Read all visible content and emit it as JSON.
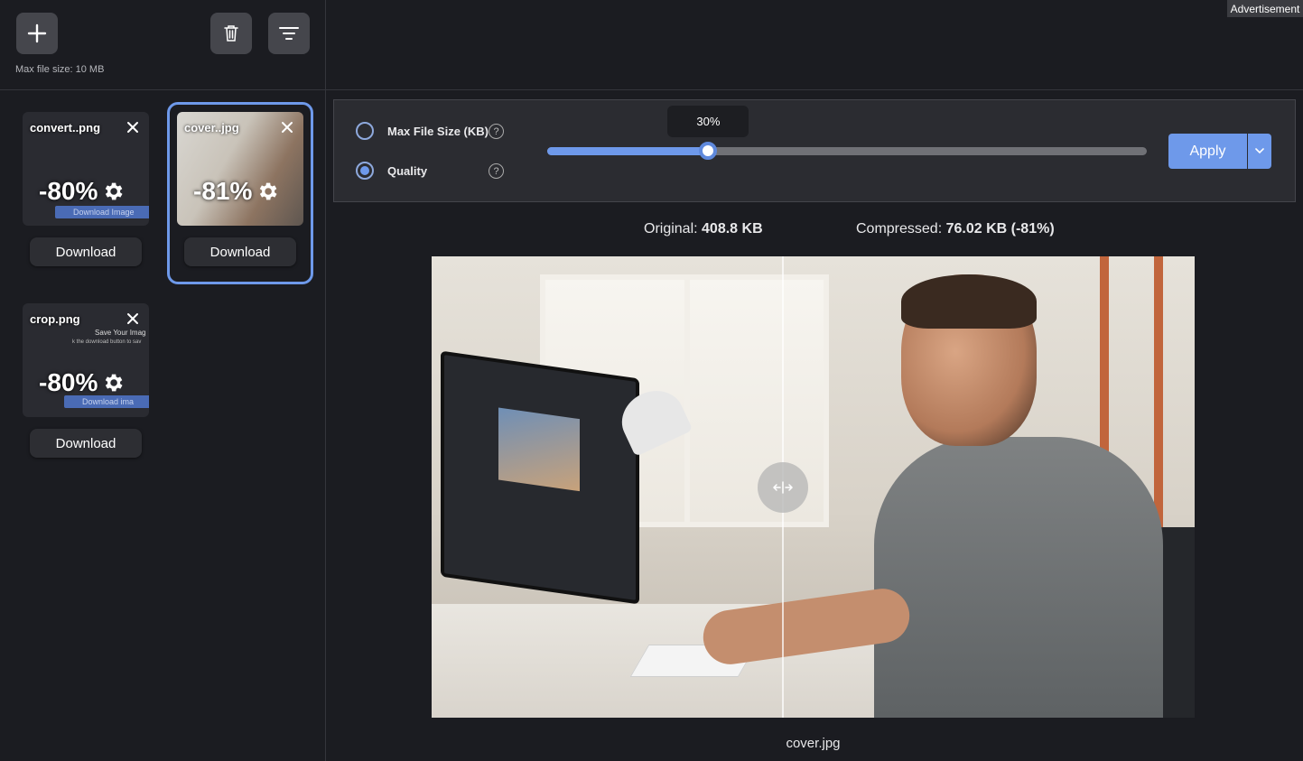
{
  "advertisement_label": "Advertisement",
  "sidebar": {
    "max_file_size_label": "Max file size: 10 MB",
    "cards": [
      {
        "filename": "convert..png",
        "reduction": "-80%",
        "download_label": "Download",
        "thumb_text": "Download Image"
      },
      {
        "filename": "cover..jpg",
        "reduction": "-81%",
        "download_label": "Download",
        "selected": true
      },
      {
        "filename": "crop.png",
        "reduction": "-80%",
        "download_label": "Download",
        "thumb_text": "Download ima",
        "thumb_heading": "Save Your Imag",
        "thumb_sub": "k the download button to sav"
      }
    ]
  },
  "controls": {
    "option_max_size": "Max File Size (KB)",
    "option_quality": "Quality",
    "selected_option": "Quality",
    "help_glyph": "?",
    "quality_percent": 30,
    "quality_label": "30%",
    "apply_label": "Apply"
  },
  "stats": {
    "original_label": "Original:",
    "original_value": "408.8 KB",
    "compressed_label": "Compressed:",
    "compressed_value": "76.02 KB (-81%)"
  },
  "preview": {
    "caption": "cover.jpg",
    "split_position": 0.46
  },
  "colors": {
    "accent": "#6e99ea",
    "background": "#1b1c21",
    "panel": "#2b2c31"
  }
}
